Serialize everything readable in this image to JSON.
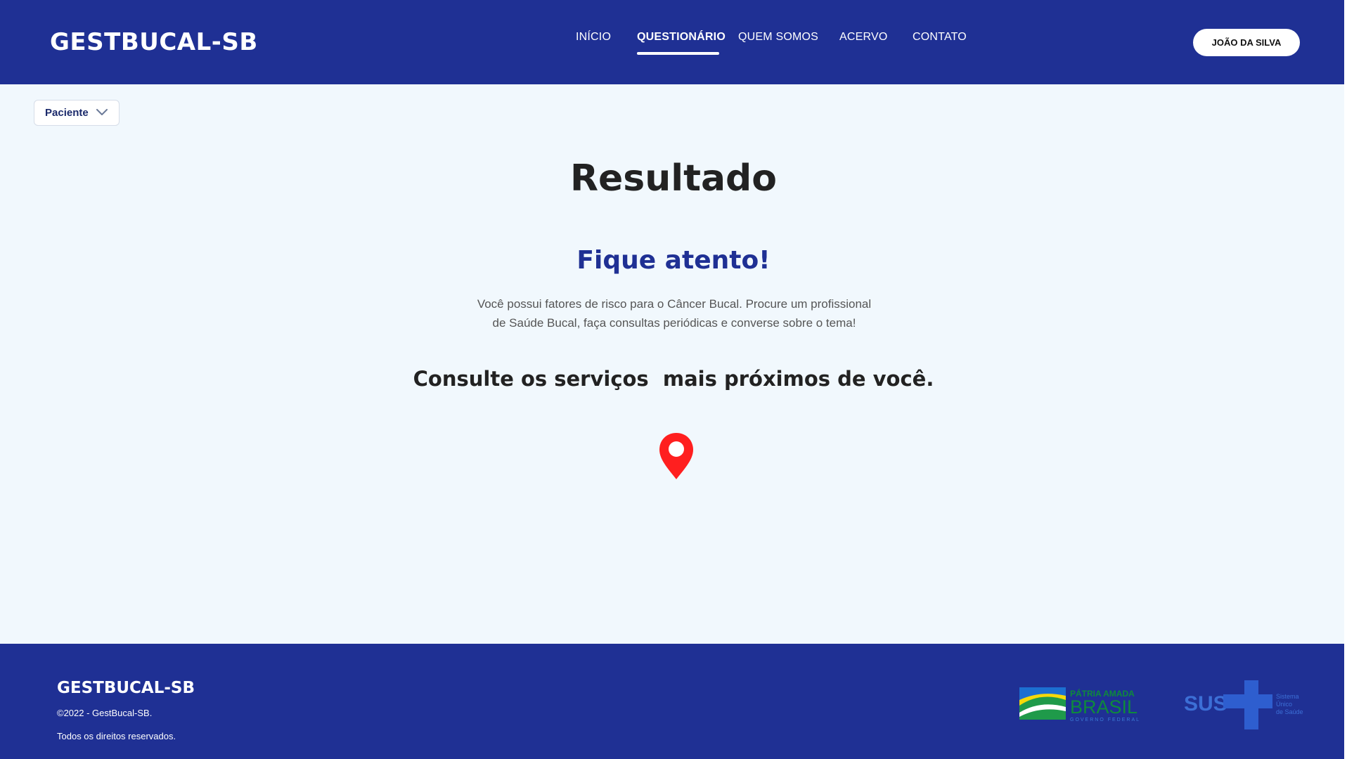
{
  "header": {
    "brand": "GESTBUCAL-SB",
    "nav": [
      {
        "label": "INÍCIO",
        "active": false
      },
      {
        "label": "QUESTIONÁRIO",
        "active": true
      },
      {
        "label": "QUEM SOMOS",
        "active": false
      },
      {
        "label": "ACERVO",
        "active": false
      },
      {
        "label": "CONTATO",
        "active": false
      }
    ],
    "user_button": "JOÃO DA SILVA"
  },
  "role_select": {
    "value": "Paciente",
    "icon": "chevron-down-icon"
  },
  "main": {
    "title": "Resultado",
    "alert_title": "Fique atento!",
    "alert_text": "Você possui fatores de risco para o Câncer Bucal. Procure um profissional de Saúde Bucal, faça consultas periódicas e converse sobre o tema!",
    "services_heading": "Consulte os serviços  mais próximos de você.",
    "map_pin_icon": "map-pin-icon",
    "map_pin_color": "#ff1f1f"
  },
  "footer": {
    "brand": "GESTBUCAL-SB",
    "copyright": "©2022 - GestBucal-SB.",
    "rights": "Todos os direitos reservados.",
    "gov_logo": {
      "line1": "PÁTRIA AMADA",
      "line2": "BRASIL",
      "line3": "GOVERNO FEDERAL"
    },
    "sus_logo": {
      "name": "SUS",
      "line1": "Sistema",
      "line2": "Único",
      "line3": "de Saúde"
    }
  },
  "colors": {
    "primary": "#1f3094",
    "background": "#f1f8fd",
    "pin": "#ff1f1f",
    "text_dark": "#222222"
  }
}
